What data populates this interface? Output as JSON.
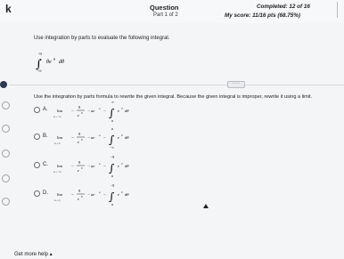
{
  "header": {
    "app_letter": "k",
    "title": "Question",
    "part": "Part 1 of 2",
    "completed": "Completed: 12 of 16",
    "score": "My score: 11/16 pts (68.75%)"
  },
  "question": {
    "instruction": "Use integration by parts to evaluate the following integral.",
    "integral": {
      "upper": "-9",
      "lower": "-∞",
      "integrand": "θe",
      "integrand_exp": "θ",
      "differential": "dθ"
    },
    "ellipsis": "·····",
    "use_formula_text": "Use the integration by parts formula to rewrite the given integral. Because the given integral is improper, rewrite it using a limit."
  },
  "options": [
    {
      "letter": "A.",
      "lim": "lim",
      "lim_sub": "a→−∞",
      "frac_num": "9",
      "frac_den": "e",
      "frac_den_exp": "9",
      "mid": "− ae",
      "mid_exp": "a",
      "minus": "−",
      "int_upper": "∞",
      "int_lower": "a",
      "integrand": "e",
      "integrand_exp": "θ",
      "diff": "dθ"
    },
    {
      "letter": "B.",
      "lim": "lim",
      "lim_sub": "a→∞",
      "frac_num": "9",
      "frac_den": "e",
      "frac_den_exp": "9",
      "mid": "− ae",
      "mid_exp": "a",
      "minus": "−",
      "int_upper": "a",
      "int_lower": "−∞",
      "integrand": "e",
      "integrand_exp": "θ",
      "diff": "dθ"
    },
    {
      "letter": "C.",
      "lim": "lim",
      "lim_sub": "a→−∞",
      "frac_num": "9",
      "frac_den": "e",
      "frac_den_exp": "9",
      "mid": "− ae",
      "mid_exp": "a",
      "minus": "−",
      "int_upper": "−9",
      "int_lower": "a",
      "integrand": "e",
      "integrand_exp": "θ",
      "diff": "dθ"
    },
    {
      "letter": "D.",
      "lim": "lim",
      "lim_sub": "a→∞",
      "frac_num": "9",
      "frac_den": "e",
      "frac_den_exp": "9",
      "mid": "− ae",
      "mid_exp": "a",
      "minus": "−",
      "int_upper": "−9",
      "int_lower": "a",
      "integrand": "e",
      "integrand_exp": "θ",
      "diff": "dθ"
    }
  ],
  "footer": {
    "help": "Get more help ▴"
  },
  "colors": {
    "background": "#f4f5f6",
    "header_bg": "#f7f8f9",
    "navy_marker": "#2a3a55",
    "radio_border": "#666666",
    "text": "#222222"
  }
}
